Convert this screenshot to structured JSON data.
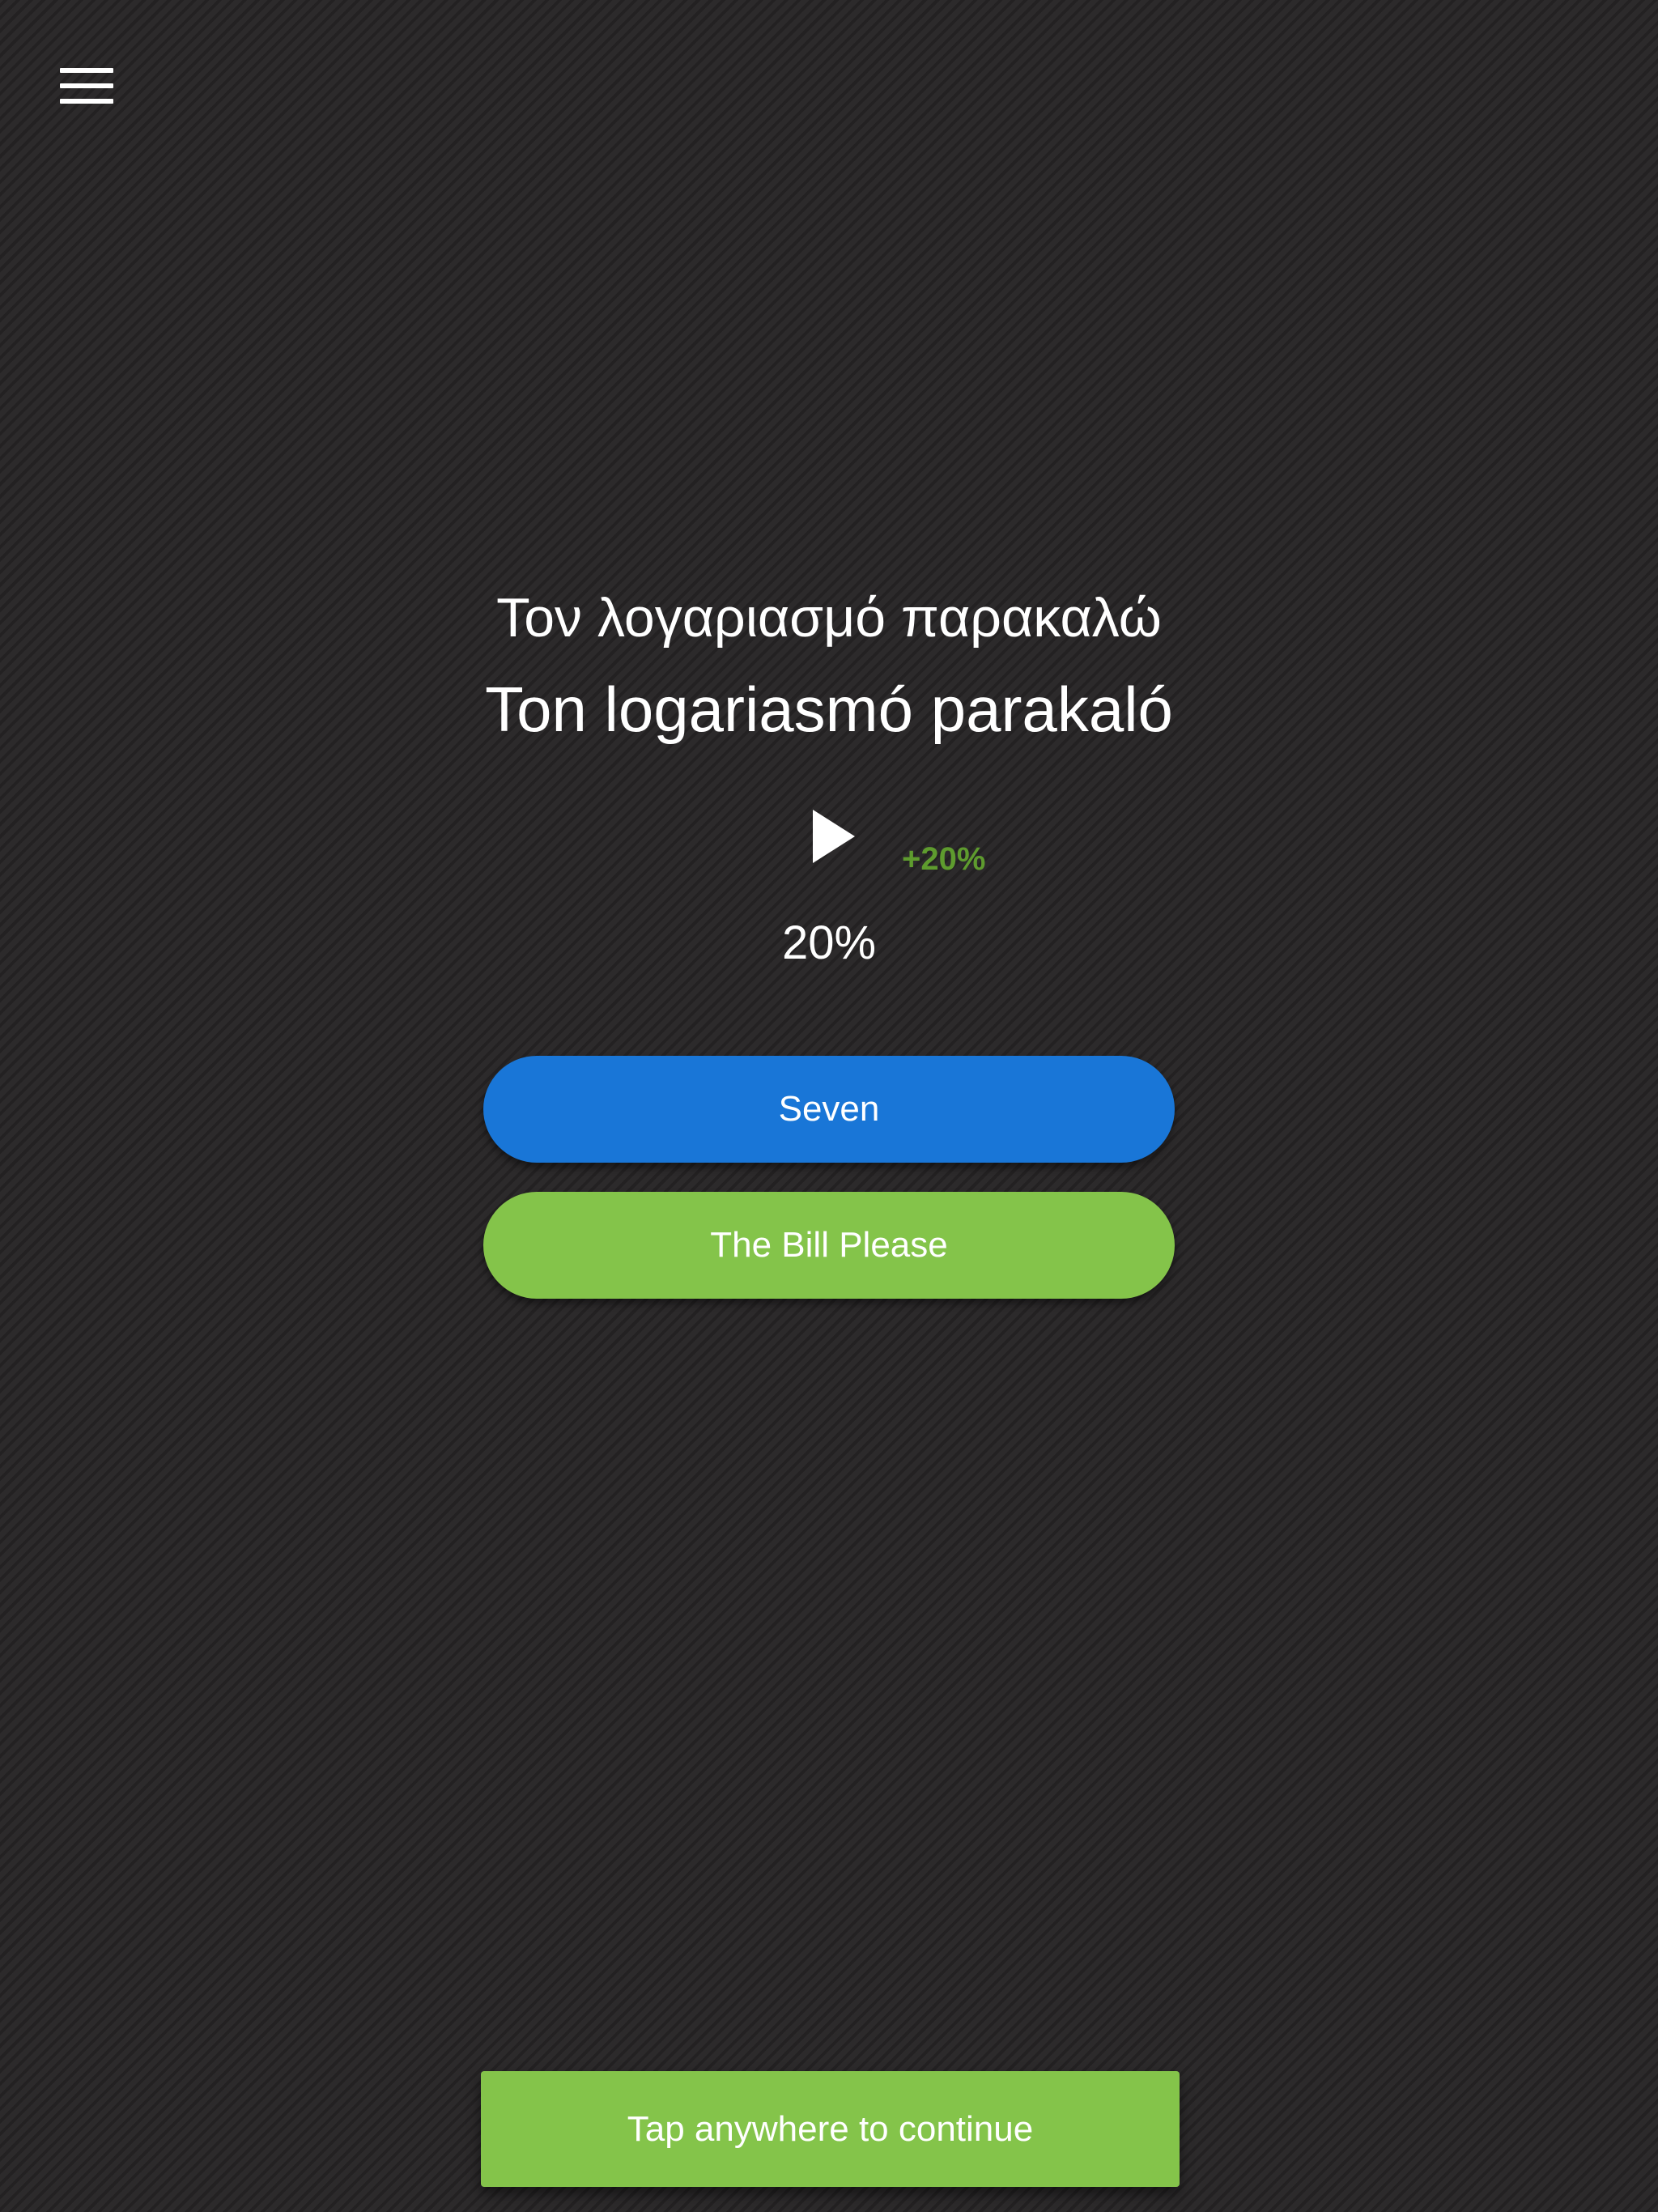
{
  "menu": {
    "icon": "hamburger-menu-icon"
  },
  "phrase": {
    "native": "Τον λογαριασμό παρακαλώ",
    "transliteration": "Ton logariasmó parakaló"
  },
  "audio": {
    "icon": "play-icon"
  },
  "progress": {
    "gain_label": "+20%",
    "percent_label": "20%",
    "percent_value": 20,
    "gain_color": "#5e9b2e"
  },
  "answers": [
    {
      "label": "Seven",
      "color": "#1976d7"
    },
    {
      "label": "The Bill Please",
      "color": "#84c44a"
    }
  ],
  "continue": {
    "label": "Tap anywhere to continue",
    "color": "#84c44a"
  }
}
